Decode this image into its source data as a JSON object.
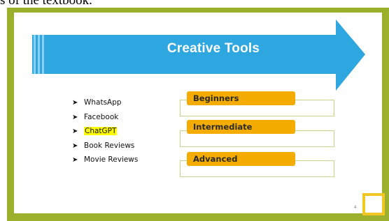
{
  "caption": {
    "text": "s of the textbook."
  },
  "slide": {
    "title": "Creative Tools",
    "bullets": [
      {
        "label": "WhatsApp",
        "highlighted": false
      },
      {
        "label": "Facebook",
        "highlighted": false
      },
      {
        "label": "ChatGPT",
        "highlighted": true
      },
      {
        "label": "Book Reviews",
        "highlighted": false
      },
      {
        "label": "Movie Reviews",
        "highlighted": false
      }
    ],
    "bullet_marker": "➤",
    "levels": [
      {
        "label": "Beginners"
      },
      {
        "label": "Intermediate"
      },
      {
        "label": "Advanced"
      }
    ],
    "page_number": "4"
  },
  "colors": {
    "frame_green": "#9db02e",
    "arrow_blue": "#2ea6df",
    "tag_orange": "#f5ac00",
    "corner_yellow": "#f3c623",
    "highlight_yellow": "#ffff00"
  }
}
